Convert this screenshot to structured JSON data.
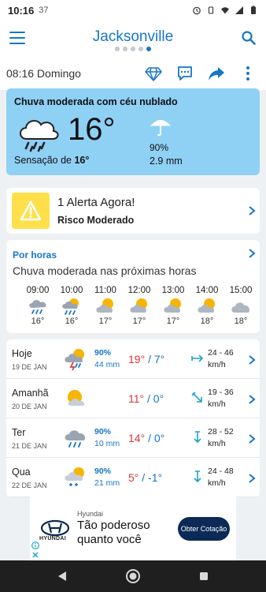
{
  "status_bar": {
    "time": "10:16",
    "temp": "37"
  },
  "header": {
    "city": "Jacksonville",
    "page_dots": 5,
    "active_dot": 4
  },
  "date_row": {
    "text": "08:16 Domingo"
  },
  "current": {
    "condition": "Chuva moderada com céu nublado",
    "temperature": "16°",
    "feels_label": "Sensação de",
    "feels_value": "16°",
    "rain_probability": "90%",
    "rain_amount": "2.9 mm",
    "icon": "cloud-rain-icon"
  },
  "alert": {
    "title": "1 Alerta Agora!",
    "level": "Risco Moderado",
    "color": "#ffe04a"
  },
  "hourly": {
    "heading": "Por horas",
    "summary": "Chuva moderada nas próximas horas",
    "hours": [
      {
        "time": "09:00",
        "temp": "16°",
        "icon": "cloud-rain-icon"
      },
      {
        "time": "10:00",
        "temp": "16°",
        "icon": "sun-cloud-rain-icon"
      },
      {
        "time": "11:00",
        "temp": "17°",
        "icon": "sun-cloud-icon"
      },
      {
        "time": "12:00",
        "temp": "17°",
        "icon": "sun-cloud-icon"
      },
      {
        "time": "13:00",
        "temp": "17°",
        "icon": "sun-cloud-icon"
      },
      {
        "time": "14:00",
        "temp": "18°",
        "icon": "sun-cloud-icon"
      },
      {
        "time": "15:00",
        "temp": "18°",
        "icon": "cloud-icon"
      }
    ]
  },
  "daily": [
    {
      "name": "Hoje",
      "date": "19 DE JAN",
      "icon": "storm-sun-icon",
      "precip_pct": "90%",
      "precip_mm": "44 mm",
      "tmax": "19°",
      "tmin": "/ 7°",
      "wind_icon": "wind-arrow-east-icon",
      "wind_speed": "24 - 46",
      "wind_unit": "km/h"
    },
    {
      "name": "Amanhã",
      "date": "20 DE JAN",
      "icon": "sun-cloud-icon",
      "precip_pct": "",
      "precip_mm": "",
      "tmax": "11°",
      "tmin": "/ 0°",
      "wind_icon": "wind-arrow-southeast-icon",
      "wind_speed": "19 - 36",
      "wind_unit": "km/h"
    },
    {
      "name": "Ter",
      "date": "21 DE JAN",
      "icon": "cloud-rain-icon",
      "precip_pct": "90%",
      "precip_mm": "10 mm",
      "tmax": "14°",
      "tmin": "/ 0°",
      "wind_icon": "wind-arrow-south-icon",
      "wind_speed": "28 - 52",
      "wind_unit": "km/h"
    },
    {
      "name": "Qua",
      "date": "22 DE JAN",
      "icon": "sun-cloud-snow-icon",
      "precip_pct": "90%",
      "precip_mm": "21 mm",
      "tmax": "5°",
      "tmin": "/ -1°",
      "wind_icon": "wind-arrow-south-icon",
      "wind_speed": "24 - 48",
      "wind_unit": "km/h"
    }
  ],
  "ad": {
    "sponsor": "Hyundai",
    "brand": "HYUNDAI",
    "headline": "Tão poderoso quanto você",
    "cta": "Obter Cotação"
  },
  "colors": {
    "accent": "#1676c8",
    "current_card": "#8fd0f5",
    "temp_max": "#d6363b",
    "ad_cta": "#0b2a56"
  }
}
